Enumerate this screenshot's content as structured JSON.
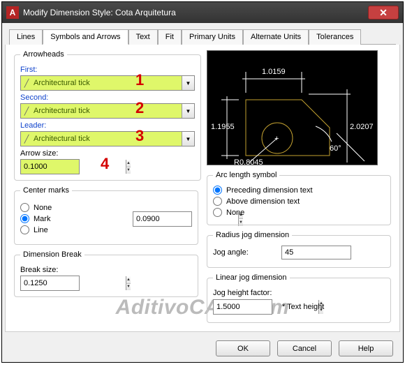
{
  "window": {
    "title": "Modify Dimension Style: Cota Arquitetura"
  },
  "tabs": {
    "t0": "Lines",
    "t1": "Symbols and Arrows",
    "t2": "Text",
    "t3": "Fit",
    "t4": "Primary Units",
    "t5": "Alternate Units",
    "t6": "Tolerances"
  },
  "arrowheads": {
    "legend": "Arrowheads",
    "first_lbl": "First:",
    "first_val": "Architectural tick",
    "second_lbl": "Second:",
    "second_val": "Architectural tick",
    "leader_lbl": "Leader:",
    "leader_val": "Architectural tick",
    "size_lbl": "Arrow size:",
    "size_val": "0.1000",
    "ann1": "1",
    "ann2": "2",
    "ann3": "3",
    "ann4": "4"
  },
  "center": {
    "legend": "Center marks",
    "none": "None",
    "mark": "Mark",
    "line": "Line",
    "val": "0.0900"
  },
  "dimbreak": {
    "legend": "Dimension Break",
    "lbl": "Break size:",
    "val": "0.1250"
  },
  "preview": {
    "d1": "1.0159",
    "d2": "1.1955",
    "d3": "2.0207",
    "ang": "60°",
    "rad": "R0.8045"
  },
  "arclen": {
    "legend": "Arc length symbol",
    "opt1": "Preceding dimension text",
    "opt2": "Above dimension text",
    "opt3": "None"
  },
  "radjog": {
    "legend": "Radius jog dimension",
    "lbl": "Jog angle:",
    "val": "45"
  },
  "linjog": {
    "legend": "Linear jog dimension",
    "lbl": "Jog height factor:",
    "val": "1.5000",
    "suffix": "* Text height"
  },
  "footer": {
    "ok": "OK",
    "cancel": "Cancel",
    "help": "Help"
  },
  "watermark": "AditivoCAD.Com"
}
